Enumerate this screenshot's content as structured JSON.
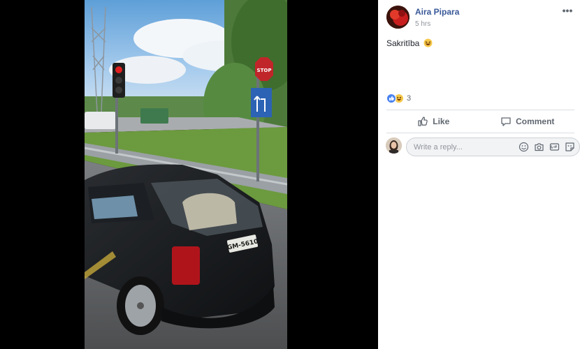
{
  "post": {
    "author": "Aira Pipara",
    "time": "5 hrs",
    "text": "Sakritība",
    "text_emoji": "laughing-emoji",
    "reactions": {
      "icons": [
        "like-icon",
        "haha-icon"
      ],
      "count": "3"
    },
    "actions": {
      "like_label": "Like",
      "comment_label": "Comment"
    },
    "reply": {
      "placeholder": "Write a reply..."
    },
    "more_label": "•••"
  },
  "photo": {
    "stop_sign_text": "STOP",
    "license_plate": "GM-5610"
  },
  "colors": {
    "author_link": "#385898",
    "secondary_text": "#90949c",
    "like_blue": "#4a83f0",
    "viewer_bg": "#000000"
  }
}
